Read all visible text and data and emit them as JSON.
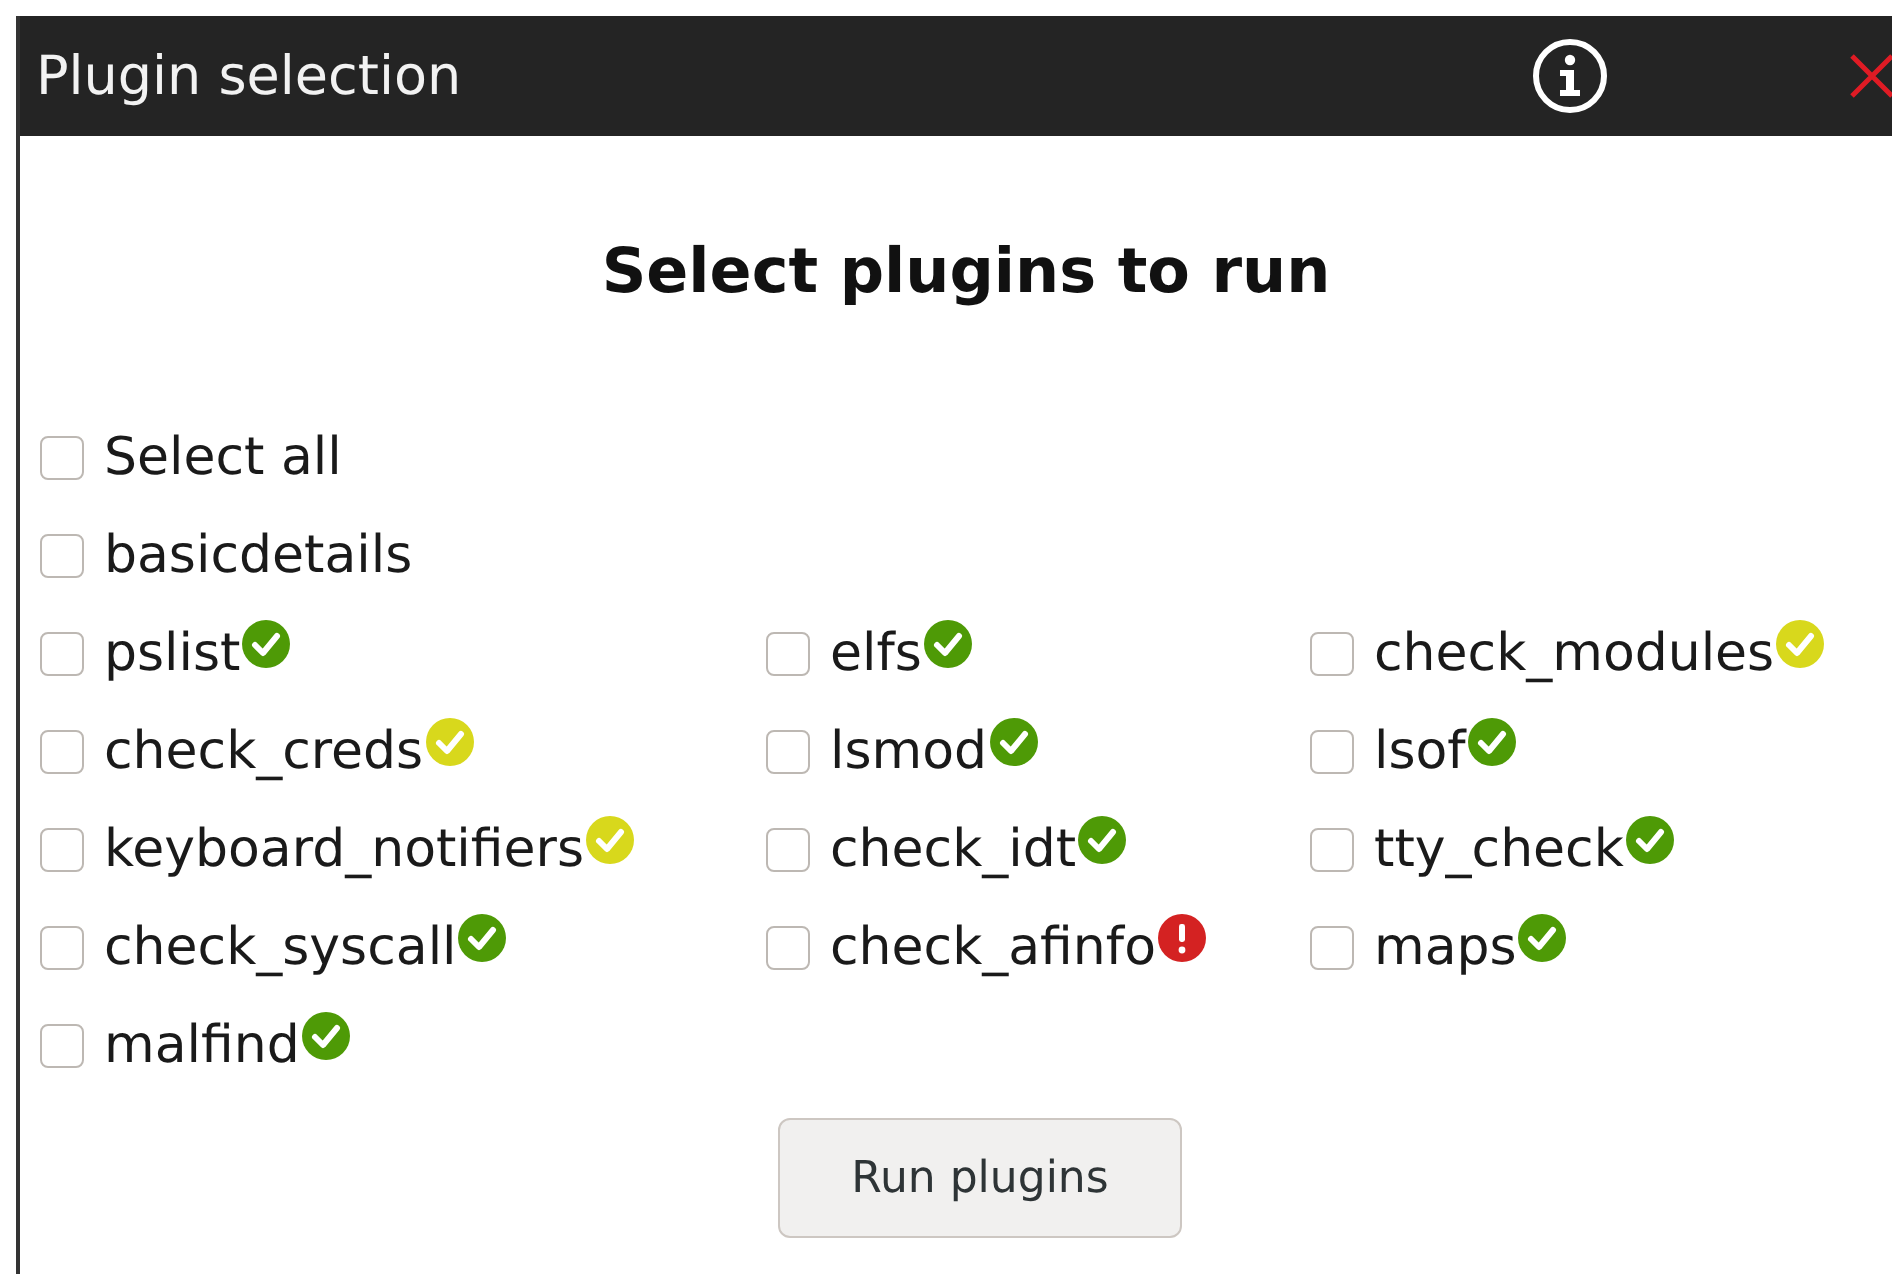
{
  "window": {
    "title": "Plugin selection"
  },
  "heading": "Select plugins to run",
  "select_all": {
    "label": "Select all",
    "checked": false
  },
  "basic": {
    "label": "basicdetails",
    "checked": false
  },
  "plugins": [
    {
      "label": "pslist",
      "checked": false,
      "kind": "check",
      "color": "#4e9a06"
    },
    {
      "label": "elfs",
      "checked": false,
      "kind": "check",
      "color": "#4e9a06"
    },
    {
      "label": "check_modules",
      "checked": false,
      "kind": "check",
      "color": "#d8d81c"
    },
    {
      "label": "check_creds",
      "checked": false,
      "kind": "check",
      "color": "#d8d81c"
    },
    {
      "label": "lsmod",
      "checked": false,
      "kind": "check",
      "color": "#4e9a06"
    },
    {
      "label": "lsof",
      "checked": false,
      "kind": "check",
      "color": "#4e9a06"
    },
    {
      "label": "keyboard_notifiers",
      "checked": false,
      "kind": "check",
      "color": "#d8d81c"
    },
    {
      "label": "check_idt",
      "checked": false,
      "kind": "check",
      "color": "#4e9a06"
    },
    {
      "label": "tty_check",
      "checked": false,
      "kind": "check",
      "color": "#4e9a06"
    },
    {
      "label": "check_syscall",
      "checked": false,
      "kind": "check",
      "color": "#4e9a06"
    },
    {
      "label": "check_afinfo",
      "checked": false,
      "kind": "alert",
      "color": "#d42222"
    },
    {
      "label": "maps",
      "checked": false,
      "kind": "check",
      "color": "#4e9a06"
    },
    {
      "label": "malfind",
      "checked": false,
      "kind": "check",
      "color": "#4e9a06"
    }
  ],
  "run_button": "Run plugins"
}
